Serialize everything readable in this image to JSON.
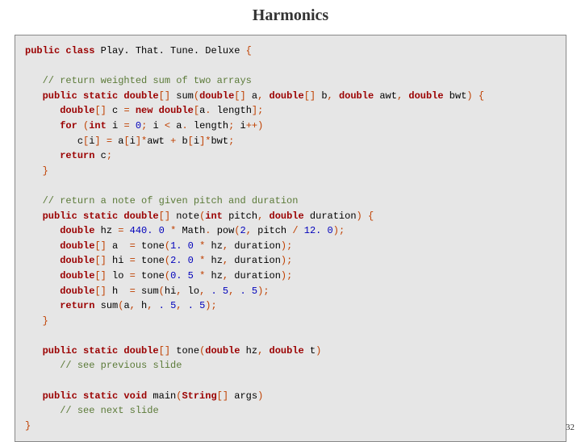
{
  "title": "Harmonics",
  "pageNumber": "32",
  "code": {
    "l0_pre": "public class",
    "l0_post": " Play. That. Tune. Deluxe ",
    "open_brace": "{",
    "cm1": "// return weighted sum of two arrays",
    "l2a": "public static double",
    "l2b": " sum",
    "l2c": "double",
    "l2d": " a",
    "l2e": "double",
    "l2f": " b",
    "l2g": "double",
    "l2h": " awt",
    "l2i": "double",
    "l2j": " bwt",
    "l3a": "double",
    "l3b": " c ",
    "l3c": "new double",
    "l3d": "a",
    "l3e": "length",
    "l4a": "for",
    "l4b": "int",
    "l4c": " i ",
    "l4d": "0",
    "l4e": " i ",
    "l4f": " a",
    "l4g": "length",
    "l4h": " i",
    "l5a": "c",
    "l5b": "i",
    "l5c": " a",
    "l5d": "i",
    "l5e": "awt ",
    "l5f": " b",
    "l5g": "i",
    "l5h": "bwt",
    "l6a": "return",
    "l6b": " c",
    "cm2": "// return a note of given pitch and duration",
    "l8a": "public static double",
    "l8b": " note",
    "l8c": "int",
    "l8d": " pitch",
    "l8e": "double",
    "l8f": " duration",
    "l9a": "double",
    "l9b": " hz ",
    "l9c": "440. 0",
    "l9d": " Math",
    "l9e": "pow",
    "l9f": "2",
    "l9g": " pitch ",
    "l9h": "12. 0",
    "l10a": "double",
    "l10b": " a  ",
    "l10c": " tone",
    "l10d": "1. 0",
    "l10e": " hz",
    "l10f": " duration",
    "l11a": "double",
    "l11b": " hi ",
    "l11c": " tone",
    "l11d": "2. 0",
    "l11e": " hz",
    "l11f": " duration",
    "l12a": "double",
    "l12b": " lo ",
    "l12c": " tone",
    "l12d": "0. 5",
    "l12e": " hz",
    "l12f": " duration",
    "l13a": "double",
    "l13b": " h  ",
    "l13c": " sum",
    "l13d": "hi",
    "l13e": " lo",
    "l13f": ". 5",
    "l13g": ". 5",
    "l14a": "return",
    "l14b": " sum",
    "l14c": "a",
    "l14d": " h",
    "l14e": ". 5",
    "l14f": ". 5",
    "l16a": "public static double",
    "l16b": " tone",
    "l16c": "double",
    "l16d": " hz",
    "l16e": "double",
    "l16f": " t",
    "cm3": "// see previous slide",
    "l18a": "public static void",
    "l18b": " main",
    "l18c": "String",
    "l18d": " args",
    "cm4": "// see next slide"
  }
}
